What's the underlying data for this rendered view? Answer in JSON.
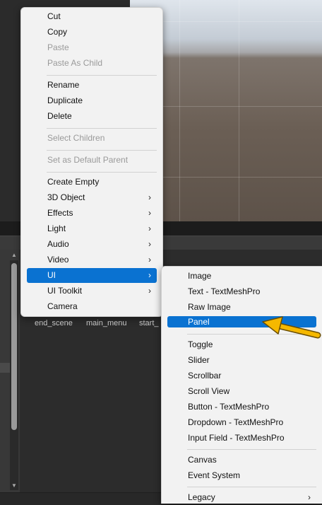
{
  "main_menu": {
    "items": [
      {
        "label": "Cut",
        "disabled": false
      },
      {
        "label": "Copy",
        "disabled": false
      },
      {
        "label": "Paste",
        "disabled": true
      },
      {
        "label": "Paste As Child",
        "disabled": true
      },
      {
        "label": "Rename",
        "disabled": false
      },
      {
        "label": "Duplicate",
        "disabled": false
      },
      {
        "label": "Delete",
        "disabled": false
      },
      {
        "label": "Select Children",
        "disabled": true
      },
      {
        "label": "Set as Default Parent",
        "disabled": true
      },
      {
        "label": "Create Empty",
        "disabled": false
      },
      {
        "label": "3D Object",
        "disabled": false,
        "submenu": true
      },
      {
        "label": "Effects",
        "disabled": false,
        "submenu": true
      },
      {
        "label": "Light",
        "disabled": false,
        "submenu": true
      },
      {
        "label": "Audio",
        "disabled": false,
        "submenu": true
      },
      {
        "label": "Video",
        "disabled": false,
        "submenu": true
      },
      {
        "label": "UI",
        "disabled": false,
        "submenu": true,
        "selected": true
      },
      {
        "label": "UI Toolkit",
        "disabled": false,
        "submenu": true
      },
      {
        "label": "Camera",
        "disabled": false
      }
    ],
    "submenu_arrow": "›"
  },
  "ui_submenu": {
    "items": [
      {
        "label": "Image"
      },
      {
        "label": "Text - TextMeshPro"
      },
      {
        "label": "Raw Image"
      },
      {
        "label": "Panel",
        "selected": true
      },
      {
        "label": "Toggle"
      },
      {
        "label": "Slider"
      },
      {
        "label": "Scrollbar"
      },
      {
        "label": "Scroll View"
      },
      {
        "label": "Button - TextMeshPro"
      },
      {
        "label": "Dropdown - TextMeshPro"
      },
      {
        "label": "Input Field - TextMeshPro"
      },
      {
        "label": "Canvas"
      },
      {
        "label": "Event System"
      },
      {
        "label": "Legacy",
        "submenu": true
      }
    ]
  },
  "project_assets": [
    "end_scene",
    "main_menu",
    "start_"
  ],
  "colors": {
    "menu_bg": "#f2f2f2",
    "selection": "#0a72d1",
    "annotation_arrow": "#f5b800"
  }
}
